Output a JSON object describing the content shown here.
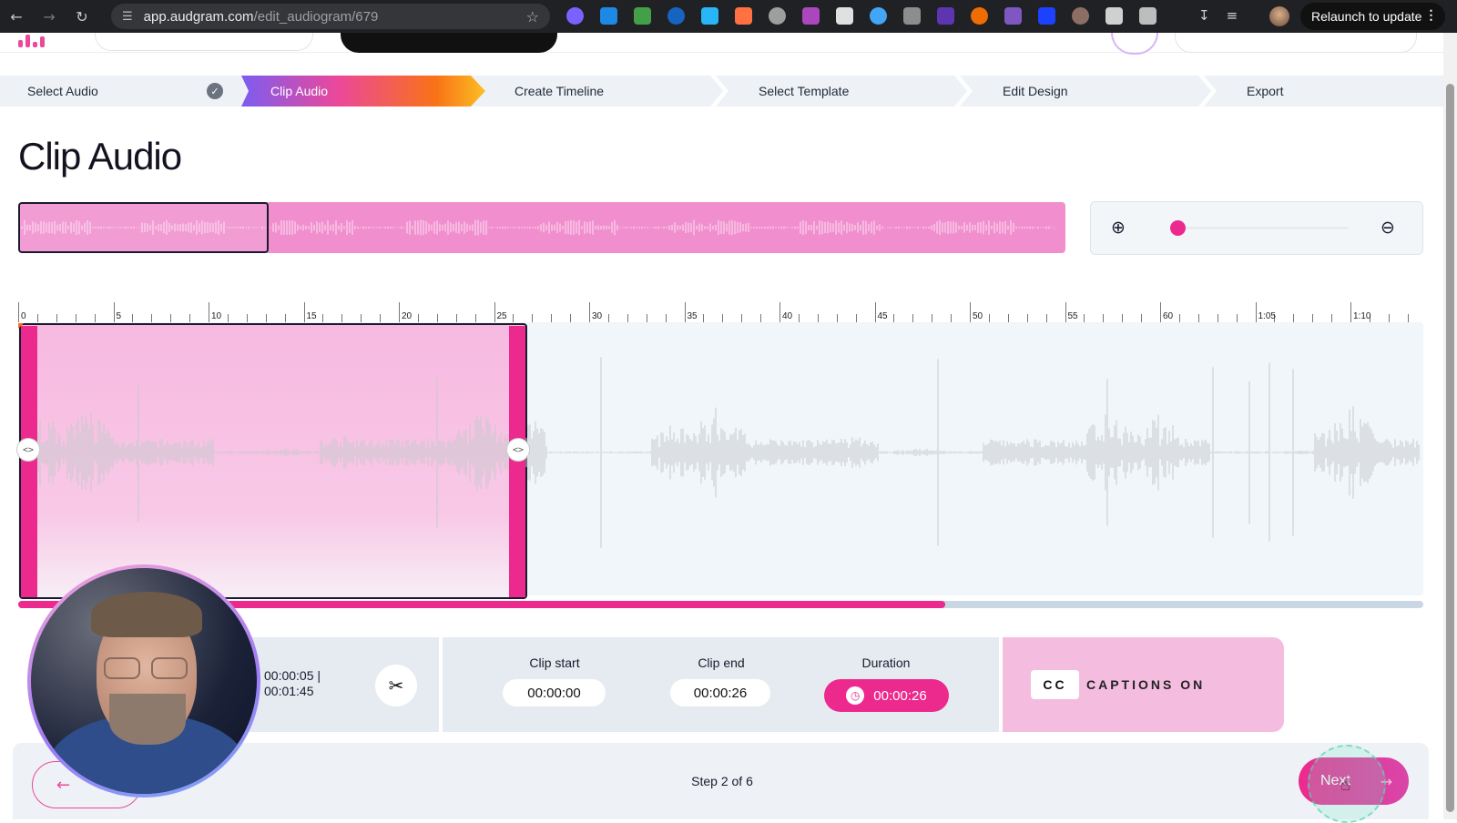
{
  "browser": {
    "url_host": "app.audgram.com",
    "url_path": "/edit_audiogram/679",
    "relaunch_label": "Relaunch to update",
    "extension_colors": [
      "#7b61ff",
      "#1e88e5",
      "#43a047",
      "#1565c0",
      "#29b6f6",
      "#ff7043",
      "#9e9e9e",
      "#ab47bc",
      "#e0e0e0",
      "#42a5f5",
      "#8d8d8d",
      "#5e35b1",
      "#ef6c00",
      "#7e57c2",
      "#1e40ff",
      "#8d6e63",
      "#d0d0d0",
      "#bdbdbd"
    ]
  },
  "stepper": {
    "steps": [
      {
        "label": "Select Audio",
        "state": "complete"
      },
      {
        "label": "Clip Audio",
        "state": "active"
      },
      {
        "label": "Create Timeline",
        "state": "pending"
      },
      {
        "label": "Select Template",
        "state": "pending"
      },
      {
        "label": "Edit Design",
        "state": "pending"
      },
      {
        "label": "Export",
        "state": "pending"
      }
    ]
  },
  "page": {
    "title": "Clip Audio"
  },
  "ruler": {
    "labels": [
      "0",
      "5",
      "10",
      "15",
      "20",
      "25",
      "30",
      "35",
      "40",
      "45",
      "50",
      "55",
      "60",
      "1:05",
      "1:10"
    ]
  },
  "timeline": {
    "progress_fraction": 0.66
  },
  "playback": {
    "current": "00:00:05 |",
    "total": "00:01:45"
  },
  "clip": {
    "start_label": "Clip start",
    "start_value": "00:00:00",
    "end_label": "Clip end",
    "end_value": "00:00:26",
    "duration_label": "Duration",
    "duration_value": "00:00:26"
  },
  "captions": {
    "cc_label": "CC",
    "status_label": "CAPTIONS ON"
  },
  "footer": {
    "step_text": "Step 2 of 6",
    "next_label": "Next"
  },
  "colors": {
    "accent": "#ec2a8e",
    "overview": "#f18fce"
  }
}
